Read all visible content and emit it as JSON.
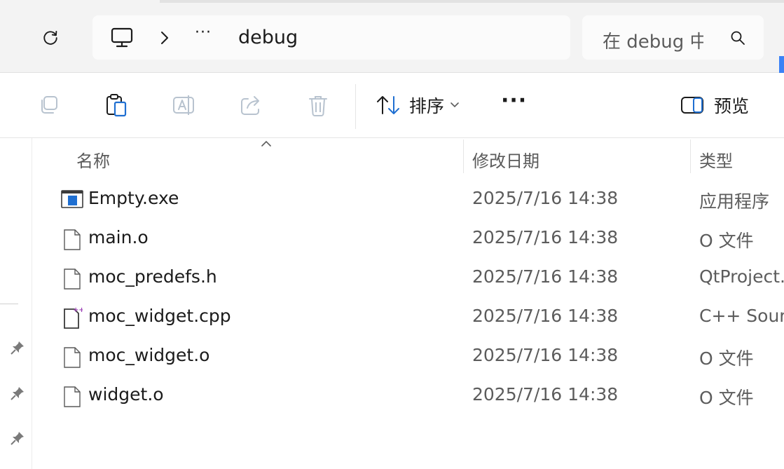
{
  "address": {
    "overflow": "···",
    "crumb": "debug"
  },
  "search": {
    "placeholder": "在 debug 中"
  },
  "toolbar": {
    "sort_label": "排序",
    "more_label": "···",
    "preview_label": "预览"
  },
  "columns": {
    "name": "名称",
    "modified": "修改日期",
    "type": "类型"
  },
  "files": [
    {
      "name": "Empty.exe",
      "modified": "2025/7/16 14:38",
      "type": "应用程序",
      "icon": "exe-icon"
    },
    {
      "name": "main.o",
      "modified": "2025/7/16 14:38",
      "type": "O 文件",
      "icon": "file-icon"
    },
    {
      "name": "moc_predefs.h",
      "modified": "2025/7/16 14:38",
      "type": "QtProject.",
      "icon": "file-icon"
    },
    {
      "name": "moc_widget.cpp",
      "modified": "2025/7/16 14:38",
      "type": "C++ Source",
      "icon": "cpp-file-icon"
    },
    {
      "name": "moc_widget.o",
      "modified": "2025/7/16 14:38",
      "type": "O 文件",
      "icon": "file-icon"
    },
    {
      "name": "widget.o",
      "modified": "2025/7/16 14:38",
      "type": "O 文件",
      "icon": "file-icon"
    }
  ],
  "colors": {
    "accent": "#3b82f6",
    "topbar_bg": "#f3f3f3",
    "disabled_icon": "#b8c3cf"
  }
}
